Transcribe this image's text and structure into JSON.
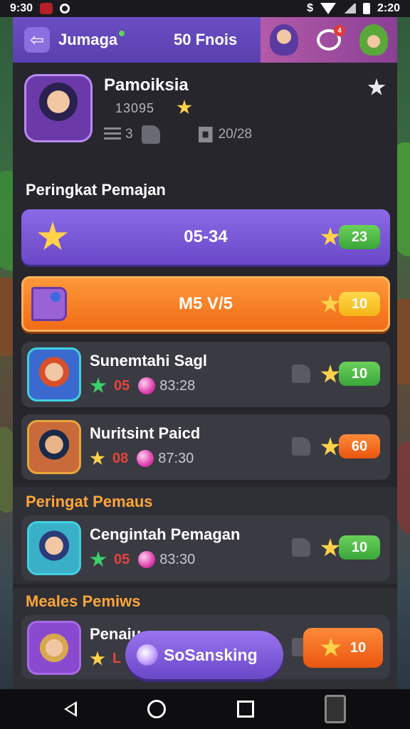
{
  "status_bar": {
    "time_left": "9:30",
    "time_right": "2:20"
  },
  "header": {
    "app_name": "Jumaga",
    "points": "50 Fnois",
    "chat_badge": "4"
  },
  "profile": {
    "name": "Pamoiksia",
    "score": "13095",
    "stat_count": "3",
    "progress": "20/28"
  },
  "ranking_section": {
    "title": "Peringkat Pemajan",
    "banner_purple": {
      "label": "05-34",
      "value": "23"
    },
    "banner_orange": {
      "label": "M5 V/5",
      "value": "10"
    }
  },
  "players": [
    {
      "name": "Sunemtahi Sagl",
      "rank": "05",
      "time": "83:28",
      "value": "10",
      "pill": "green"
    },
    {
      "name": "Nuritsint Paicd",
      "rank": "08",
      "time": "87:30",
      "value": "60",
      "pill": "orange"
    }
  ],
  "section2": {
    "title": "Peringat Pemaus",
    "player": {
      "name": "Cengintah Pemagan",
      "rank": "05",
      "time": "83:30",
      "value": "10"
    }
  },
  "section3": {
    "title": "Meales Pemiws",
    "player": {
      "name": "Penaiu",
      "rank": "L",
      "value": "10"
    }
  },
  "fab": {
    "label": "SoSansking"
  },
  "colors": {
    "accent_purple": "#6a48c8",
    "accent_orange": "#f06a14",
    "pill_green": "#3aa63a",
    "star_yellow": "#ffd24a"
  }
}
